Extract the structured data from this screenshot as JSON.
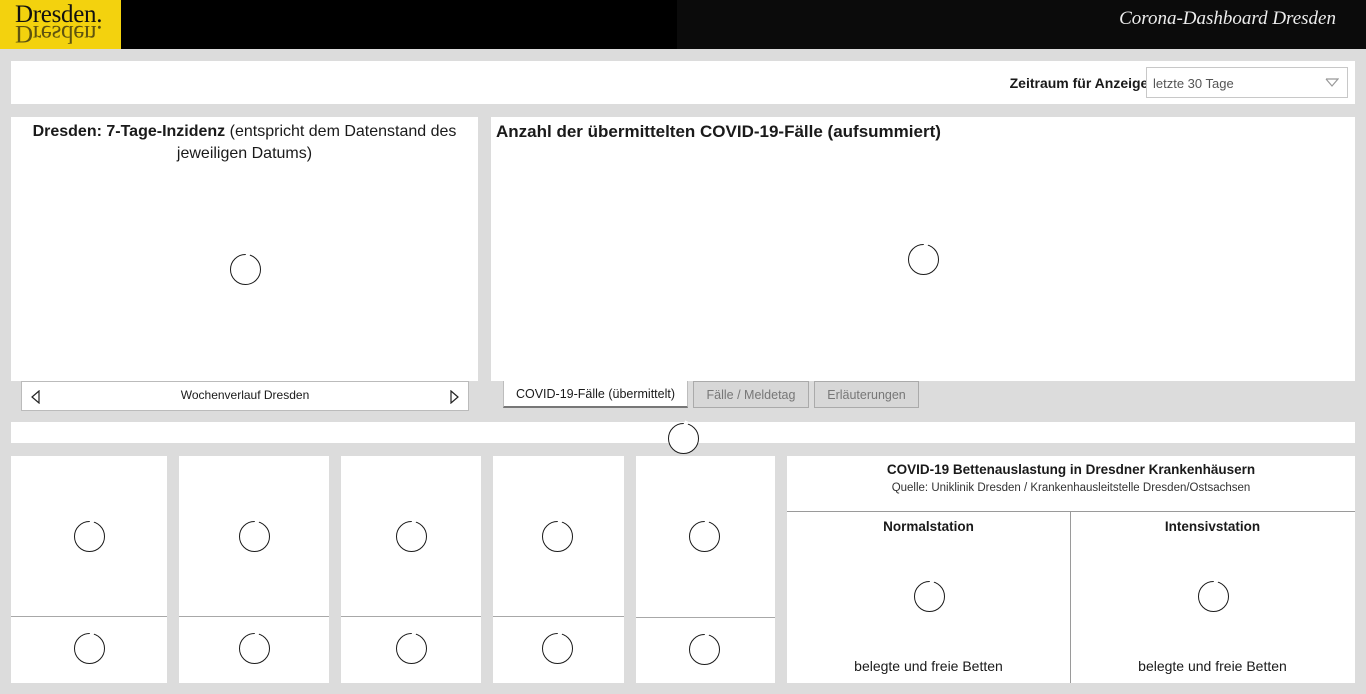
{
  "header": {
    "logo_text": "Dresden.",
    "title": "Corona-Dashboard Dresden"
  },
  "filter": {
    "label": "Zeitraum für Anzeige:",
    "selected": "letzte 30 Tage"
  },
  "incidence_panel": {
    "title_bold": "Dresden: 7-Tage-Inzidenz",
    "title_rest": "(entspricht dem Datenstand des jeweiligen Datums)",
    "nav_label": "Wochenverlauf Dresden"
  },
  "cases_panel": {
    "title": "Anzahl der übermittelten COVID-19-Fälle (aufsummiert)",
    "tabs": [
      {
        "label": "COVID-19-Fälle (übermittelt)",
        "active": true
      },
      {
        "label": "Fälle / Meldetag",
        "active": false
      },
      {
        "label": "Erläuterungen",
        "active": false
      }
    ]
  },
  "beds": {
    "title": "COVID-19 Bettenauslastung in Dresdner Krankenhäusern",
    "source": "Quelle: Uniklinik Dresden / Krankenhausleitstelle Dresden/Ostsachsen",
    "normal": {
      "title": "Normalstation",
      "footer": "belegte und freie Betten"
    },
    "icu": {
      "title": "Intensivstation",
      "footer": "belegte und freie Betten"
    }
  },
  "colors": {
    "logo_bg": "#f3d20e",
    "header_bg": "#000000",
    "page_bg": "#dcdcdc"
  },
  "icons": {
    "loading": "loading-spinner-icon",
    "dropdown": "chevron-down-icon",
    "prev": "triangle-left-icon",
    "next": "triangle-right-icon"
  }
}
